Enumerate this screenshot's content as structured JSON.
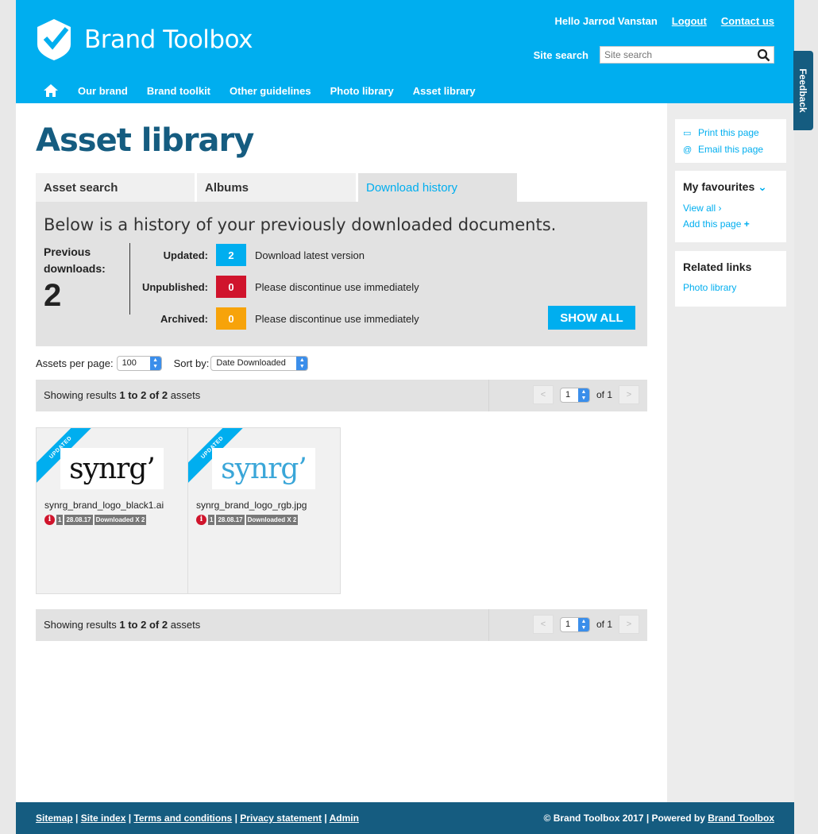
{
  "header": {
    "brand": "Brand Toolbox",
    "greeting": "Hello Jarrod Vanstan",
    "logout": "Logout",
    "contact": "Contact us",
    "search_label": "Site search",
    "search_placeholder": "Site search"
  },
  "nav": {
    "items": [
      "Our brand",
      "Brand toolkit",
      "Other guidelines",
      "Photo library",
      "Asset library"
    ]
  },
  "main": {
    "title": "Asset library",
    "tabs": [
      "Asset search",
      "Albums",
      "Download history"
    ],
    "lead": "Below is a history of your previously downloaded documents.",
    "prev_label_1": "Previous",
    "prev_label_2": "downloads:",
    "prev_count": "2",
    "stats": [
      {
        "label": "Updated:",
        "value": "2",
        "color": "#00aeef",
        "desc": "Download latest version"
      },
      {
        "label": "Unpublished:",
        "value": "0",
        "color": "#d0142c",
        "desc": "Please discontinue use immediately"
      },
      {
        "label": "Archived:",
        "value": "0",
        "color": "#f7a30a",
        "desc": "Please discontinue use immediately"
      }
    ],
    "show_all": "SHOW ALL",
    "per_page_label": "Assets per page:",
    "per_page_value": "100",
    "sort_label": "Sort by:",
    "sort_value": "Date Downloaded",
    "results_prefix": "Showing results ",
    "results_range": "1 to 2 of 2",
    "results_suffix": " assets",
    "page_value": "1",
    "page_of": "of 1",
    "prev_btn": "<",
    "next_btn": ">",
    "assets": [
      {
        "ribbon": "UPDATED",
        "logo": "synrg’",
        "logo_color": "#111111",
        "name": "synrg_brand_logo_black1.ai",
        "info": "i",
        "version": "1",
        "date": "28.08.17",
        "downloads": "Downloaded X 2"
      },
      {
        "ribbon": "UPDATED",
        "logo": "synrg’",
        "logo_color": "#3aa6d8",
        "name": "synrg_brand_logo_rgb.jpg",
        "info": "i",
        "version": "1",
        "date": "28.08.17",
        "downloads": "Downloaded X 2"
      }
    ]
  },
  "sidebar": {
    "print": "Print this page",
    "email": "Email this page",
    "favourites_title": "My favourites",
    "view_all": "View all",
    "add_page": "Add this page",
    "related_title": "Related links",
    "related_items": [
      "Photo library"
    ]
  },
  "feedback": "Feedback",
  "footer": {
    "links": [
      "Sitemap",
      "Site index",
      "Terms and conditions",
      "Privacy statement",
      "Admin"
    ],
    "copyright": "© Brand Toolbox 2017",
    "powered_prefix": "Powered by ",
    "powered_link": "Brand Toolbox"
  },
  "colors": {
    "brand_blue": "#00aeef",
    "dark_blue": "#155c80",
    "updated": "#00aeef",
    "unpublished": "#d0142c",
    "archived": "#f7a30a"
  }
}
